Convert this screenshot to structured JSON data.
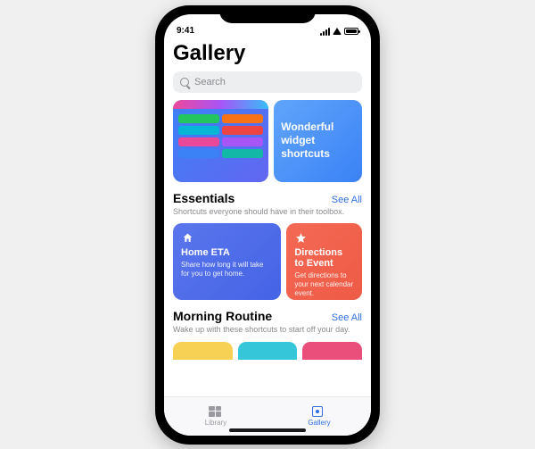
{
  "status": {
    "time": "9:41"
  },
  "page": {
    "title": "Gallery"
  },
  "search": {
    "placeholder": "Search"
  },
  "hero": {
    "right_title": "Wonderful widget shortcuts",
    "pills": [
      {
        "bg": "#22c55e"
      },
      {
        "bg": "#f97316"
      },
      {
        "bg": "#06b6d4"
      },
      {
        "bg": "#ef4444"
      },
      {
        "bg": "#ec4899"
      },
      {
        "bg": "#a855f7"
      },
      {
        "bg": "#3b82f6"
      },
      {
        "bg": "#14b8a6"
      }
    ]
  },
  "sections": {
    "essentials": {
      "title": "Essentials",
      "see_all": "See All",
      "subtitle": "Shortcuts everyone should have in their toolbox.",
      "cards": [
        {
          "title": "Home ETA",
          "desc": "Share how long it will take for you to get home.",
          "gradient_from": "#5b76ec",
          "gradient_to": "#4463e6",
          "icon": "home-icon"
        },
        {
          "title": "Directions to Event",
          "desc": "Get directions to your next calendar event.",
          "gradient_from": "#f46a55",
          "gradient_to": "#ee5a45",
          "icon": "star-icon"
        }
      ]
    },
    "morning": {
      "title": "Morning Routine",
      "see_all": "See All",
      "subtitle": "Wake up with these shortcuts to start off your day.",
      "cards": [
        {
          "color": "#f7d154"
        },
        {
          "color": "#35c6d9"
        },
        {
          "color": "#e94f7a"
        }
      ]
    }
  },
  "tabs": {
    "library": "Library",
    "gallery": "Gallery",
    "active": "gallery"
  }
}
